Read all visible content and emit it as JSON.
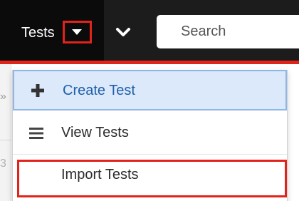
{
  "navbar": {
    "module_label": "Tests",
    "more_icon": "chevron-down-icon",
    "search": {
      "placeholder": "Search",
      "value": ""
    }
  },
  "page": {
    "expand_glyph": "»",
    "partial_glyph": "3"
  },
  "menu": {
    "items": [
      {
        "label": "Create Test",
        "icon": "plus-icon",
        "state": "hovered"
      },
      {
        "label": "View Tests",
        "icon": "list-icon",
        "state": "default"
      },
      {
        "label": "Import Tests",
        "icon": "",
        "state": "highlighted"
      }
    ]
  },
  "colors": {
    "navbar_bg": "#1c1c1c",
    "accent_red": "#e2231a",
    "hover_bg": "#dbe9fb",
    "hover_border": "#8fb6e6",
    "link_blue": "#1f5fa8"
  }
}
